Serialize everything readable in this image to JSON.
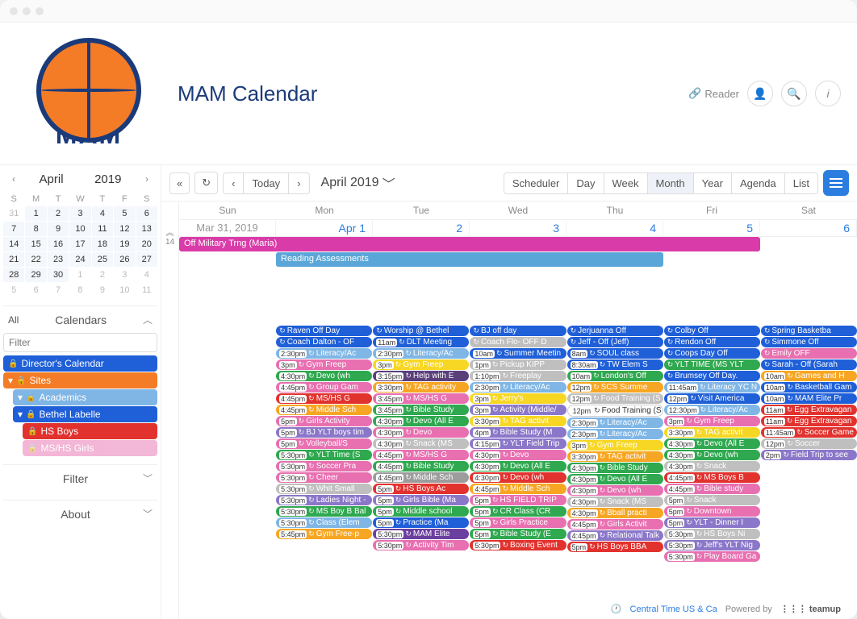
{
  "header": {
    "logo_text": "MAM",
    "title": "MAM Calendar",
    "reader": "Reader"
  },
  "minical": {
    "month": "April",
    "year": "2019",
    "dow": [
      "S",
      "M",
      "T",
      "W",
      "T",
      "F",
      "S"
    ],
    "days": [
      {
        "n": "31",
        "out": true
      },
      {
        "n": "1"
      },
      {
        "n": "2"
      },
      {
        "n": "3"
      },
      {
        "n": "4"
      },
      {
        "n": "5"
      },
      {
        "n": "6"
      },
      {
        "n": "7"
      },
      {
        "n": "8"
      },
      {
        "n": "9"
      },
      {
        "n": "10"
      },
      {
        "n": "11"
      },
      {
        "n": "12"
      },
      {
        "n": "13"
      },
      {
        "n": "14"
      },
      {
        "n": "15"
      },
      {
        "n": "16"
      },
      {
        "n": "17"
      },
      {
        "n": "18"
      },
      {
        "n": "19"
      },
      {
        "n": "20"
      },
      {
        "n": "21"
      },
      {
        "n": "22"
      },
      {
        "n": "23"
      },
      {
        "n": "24"
      },
      {
        "n": "25"
      },
      {
        "n": "26"
      },
      {
        "n": "27"
      },
      {
        "n": "28"
      },
      {
        "n": "29"
      },
      {
        "n": "30"
      },
      {
        "n": "1",
        "out": true
      },
      {
        "n": "2",
        "out": true
      },
      {
        "n": "3",
        "out": true
      },
      {
        "n": "4",
        "out": true
      },
      {
        "n": "5",
        "out": true
      },
      {
        "n": "6",
        "out": true
      },
      {
        "n": "7",
        "out": true
      },
      {
        "n": "8",
        "out": true
      },
      {
        "n": "9",
        "out": true
      },
      {
        "n": "10",
        "out": true
      },
      {
        "n": "11",
        "out": true
      }
    ]
  },
  "sidebar": {
    "all": "All",
    "calendars_label": "Calendars",
    "filter_placeholder": "Filter",
    "calendars": [
      {
        "label": "Director's Calendar",
        "color": "#1f5fd8",
        "lock": true
      },
      {
        "label": "Sites",
        "color": "#f47c26",
        "lock": true,
        "arrow": true
      },
      {
        "label": "Academics",
        "color": "#7fb6e6",
        "lock": true,
        "arrow": true,
        "indent": 1
      },
      {
        "label": "Bethel Labelle",
        "color": "#1f5fd8",
        "lock": true,
        "arrow": true,
        "indent": 1
      },
      {
        "label": "HS Boys",
        "color": "#e2322e",
        "lock": true,
        "indent": 2
      },
      {
        "label": "MS/HS Girls",
        "color": "#e86fb0",
        "lock": true,
        "indent": 2,
        "faded": true
      }
    ],
    "filter_section": "Filter",
    "about_section": "About"
  },
  "toolbar": {
    "today": "Today",
    "month_label": "April 2019",
    "views": [
      "Scheduler",
      "Day",
      "Week",
      "Month",
      "Year",
      "Agenda",
      "List"
    ],
    "active_view": "Month"
  },
  "calendar": {
    "week_num": "14",
    "dow": [
      "Sun",
      "Mon",
      "Tue",
      "Wed",
      "Thu",
      "Fri",
      "Sat"
    ],
    "dates": [
      "Mar 31, 2019",
      "Apr 1",
      "2",
      "3",
      "4",
      "5",
      "6"
    ],
    "allday": [
      {
        "label": "Off Military Trng (Maria)",
        "color": "#d93ba8",
        "span": "span6"
      },
      {
        "label": "Reading Assessments",
        "color": "#5aa6d8",
        "span": "span4"
      }
    ],
    "columns": [
      [],
      [
        {
          "t": "",
          "txt": "Raven Off Day",
          "c": "#1f5fd8"
        },
        {
          "t": "",
          "txt": "Coach Dalton - OF",
          "c": "#1f5fd8"
        },
        {
          "t": "2:30pm",
          "txt": "Literacy/Ac",
          "c": "#7fb6e6"
        },
        {
          "t": "3pm",
          "txt": "Gym Freep",
          "c": "#e86fb0"
        },
        {
          "t": "4:30pm",
          "txt": "Devo (wh",
          "c": "#2fa84f"
        },
        {
          "t": "4:45pm",
          "txt": "Group Gam",
          "c": "#e86fb0"
        },
        {
          "t": "4:45pm",
          "txt": "MS/HS G",
          "c": "#e2322e"
        },
        {
          "t": "4:45pm",
          "txt": "Middle Sch",
          "c": "#f7a623"
        },
        {
          "t": "5pm",
          "txt": "Girls Activity",
          "c": "#e86fb0"
        },
        {
          "t": "5pm",
          "txt": "BJ YLT boys tim",
          "c": "#8b77c9"
        },
        {
          "t": "5pm",
          "txt": "Volleyball/S",
          "c": "#e86fb0"
        },
        {
          "t": "5:30pm",
          "txt": "YLT Time (S",
          "c": "#2fa84f"
        },
        {
          "t": "5:30pm",
          "txt": "Soccer Pra",
          "c": "#e86fb0"
        },
        {
          "t": "5:30pm",
          "txt": "Cheer",
          "c": "#e86fb0"
        },
        {
          "t": "5:30pm",
          "txt": "Whit Small",
          "c": "#bfbfbf"
        },
        {
          "t": "5:30pm",
          "txt": "Ladies Night -",
          "c": "#8b77c9"
        },
        {
          "t": "5:30pm",
          "txt": "MS Boy B Bal",
          "c": "#2fa84f"
        },
        {
          "t": "5:30pm",
          "txt": "Class (Elem",
          "c": "#7fb6e6"
        },
        {
          "t": "5:45pm",
          "txt": "Gym Free-p",
          "c": "#f7a623"
        }
      ],
      [
        {
          "t": "",
          "txt": "Worship @ Bethel",
          "c": "#1f5fd8"
        },
        {
          "t": "11am",
          "txt": "DLT Meeting",
          "c": "#1f5fd8"
        },
        {
          "t": "2:30pm",
          "txt": "Literacy/Ac",
          "c": "#7fb6e6"
        },
        {
          "t": "3pm",
          "txt": "Gym Freep",
          "c": "#f7d723"
        },
        {
          "t": "3:15pm",
          "txt": "Help with E",
          "c": "#5a3f7a"
        },
        {
          "t": "3:30pm",
          "txt": "TAG activity",
          "c": "#f7a623"
        },
        {
          "t": "3:45pm",
          "txt": "MS/HS G",
          "c": "#e86fb0"
        },
        {
          "t": "3:45pm",
          "txt": "Bible Study",
          "c": "#2fa84f"
        },
        {
          "t": "4:30pm",
          "txt": "Devo (All E",
          "c": "#2fa84f"
        },
        {
          "t": "4:30pm",
          "txt": "Devo",
          "c": "#e86fb0"
        },
        {
          "t": "4:30pm",
          "txt": "Snack (MS",
          "c": "#bfbfbf"
        },
        {
          "t": "4:45pm",
          "txt": "MS/HS G",
          "c": "#e86fb0"
        },
        {
          "t": "4:45pm",
          "txt": "Bible Study",
          "c": "#2fa84f"
        },
        {
          "t": "4:45pm",
          "txt": "Middle Sch",
          "c": "#9c9c9c"
        },
        {
          "t": "5pm",
          "txt": "HS Boys Ac",
          "c": "#e2322e"
        },
        {
          "t": "5pm",
          "txt": "Girls Bible (Ma",
          "c": "#8b77c9"
        },
        {
          "t": "5pm",
          "txt": "Middle school",
          "c": "#2fa84f"
        },
        {
          "t": "5pm",
          "txt": "Practice (Ma",
          "c": "#1f5fd8"
        },
        {
          "t": "5:30pm",
          "txt": "MAM Elite",
          "c": "#6b3fa0"
        },
        {
          "t": "5:30pm",
          "txt": "Activity Tim",
          "c": "#e86fb0"
        }
      ],
      [
        {
          "t": "",
          "txt": "BJ off day",
          "c": "#1f5fd8"
        },
        {
          "t": "",
          "txt": "Coach Flo- OFF D",
          "c": "#bfbfbf"
        },
        {
          "t": "10am",
          "txt": "Summer Meetin",
          "c": "#1f5fd8"
        },
        {
          "t": "1pm",
          "txt": "Pickup KIPP",
          "c": "#bfbfbf"
        },
        {
          "t": "1:10pm",
          "txt": "Freeplay",
          "c": "#bfbfbf"
        },
        {
          "t": "2:30pm",
          "txt": "Literacy/Ac",
          "c": "#7fb6e6"
        },
        {
          "t": "3pm",
          "txt": "Jerry's",
          "c": "#f7d723"
        },
        {
          "t": "3pm",
          "txt": "Activity (Middle/",
          "c": "#8b77c9"
        },
        {
          "t": "3:30pm",
          "txt": "TAG activit",
          "c": "#f7d723"
        },
        {
          "t": "4pm",
          "txt": "Bible Study (M",
          "c": "#8b77c9"
        },
        {
          "t": "4:15pm",
          "txt": "YLT Field Trip",
          "c": "#8b77c9"
        },
        {
          "t": "4:30pm",
          "txt": "Devo",
          "c": "#e86fb0"
        },
        {
          "t": "4:30pm",
          "txt": "Devo (All E",
          "c": "#2fa84f"
        },
        {
          "t": "4:30pm",
          "txt": "Devo (wh",
          "c": "#e2322e"
        },
        {
          "t": "4:45pm",
          "txt": "Middle Sch",
          "c": "#f7a623"
        },
        {
          "t": "5pm",
          "txt": "HS FIELD TRIP",
          "c": "#e86fb0"
        },
        {
          "t": "5pm",
          "txt": "CR Class (CR",
          "c": "#2fa84f"
        },
        {
          "t": "5pm",
          "txt": "Girls Practice",
          "c": "#e86fb0"
        },
        {
          "t": "5pm",
          "txt": "Bible Study (E",
          "c": "#2fa84f"
        },
        {
          "t": "5:30pm",
          "txt": "Boxing Event",
          "c": "#e2322e"
        }
      ],
      [
        {
          "t": "",
          "txt": "Jerjuanna Off",
          "c": "#1f5fd8"
        },
        {
          "t": "",
          "txt": "Jeff - Off (Jeff)",
          "c": "#1f5fd8"
        },
        {
          "t": "8am",
          "txt": "SOUL class",
          "c": "#1f5fd8"
        },
        {
          "t": "8:30am",
          "txt": "TW Elem S",
          "c": "#1f5fd8"
        },
        {
          "t": "10am",
          "txt": "London's Off",
          "c": "#2fa84f"
        },
        {
          "t": "12pm",
          "txt": "SCS Summe",
          "c": "#f7a623"
        },
        {
          "t": "12pm",
          "txt": "Food Training (S",
          "c": "#bfbfbf"
        },
        {
          "t": "12pm",
          "txt": "Food Training (S",
          "c": "#ffffff",
          "tc": "#333"
        },
        {
          "t": "2:30pm",
          "txt": "Literacy/Ac",
          "c": "#7fb6e6"
        },
        {
          "t": "2:30pm",
          "txt": "Literacy/Ac",
          "c": "#7fb6e6"
        },
        {
          "t": "3pm",
          "txt": "Gym Freep",
          "c": "#f7d723"
        },
        {
          "t": "3:30pm",
          "txt": "TAG activit",
          "c": "#f7a623"
        },
        {
          "t": "4:30pm",
          "txt": "Bible Study",
          "c": "#2fa84f"
        },
        {
          "t": "4:30pm",
          "txt": "Devo (All E",
          "c": "#2fa84f"
        },
        {
          "t": "4:30pm",
          "txt": "Devo (wh",
          "c": "#e86fb0"
        },
        {
          "t": "4:30pm",
          "txt": "Snack (MS",
          "c": "#bfbfbf"
        },
        {
          "t": "4:30pm",
          "txt": "Bball practi",
          "c": "#f7a623"
        },
        {
          "t": "4:45pm",
          "txt": "Girls Activit",
          "c": "#e86fb0"
        },
        {
          "t": "4:45pm",
          "txt": "Relational Talk",
          "c": "#8b77c9"
        },
        {
          "t": "5pm",
          "txt": "HS Boys BBA",
          "c": "#e2322e"
        }
      ],
      [
        {
          "t": "",
          "txt": "Colby Off",
          "c": "#1f5fd8"
        },
        {
          "t": "",
          "txt": "Rendon Off",
          "c": "#1f5fd8"
        },
        {
          "t": "",
          "txt": "Coops Day Off",
          "c": "#1f5fd8"
        },
        {
          "t": "",
          "txt": "YLT TIME (MS YLT",
          "c": "#2fa84f"
        },
        {
          "t": "",
          "txt": "Brumsey Off Day.",
          "c": "#1f5fd8"
        },
        {
          "t": "11:45am",
          "txt": "Literacy YC N",
          "c": "#7fb6e6"
        },
        {
          "t": "12pm",
          "txt": "Visit America",
          "c": "#1f5fd8"
        },
        {
          "t": "12:30pm",
          "txt": "Literacy/Ac",
          "c": "#7fb6e6"
        },
        {
          "t": "3pm",
          "txt": "Gym Freep",
          "c": "#e86fb0"
        },
        {
          "t": "3:30pm",
          "txt": "TAG activit",
          "c": "#f7d723"
        },
        {
          "t": "4:30pm",
          "txt": "Devo (All E",
          "c": "#2fa84f"
        },
        {
          "t": "4:30pm",
          "txt": "Devo (wh",
          "c": "#2fa84f"
        },
        {
          "t": "4:30pm",
          "txt": "Snack",
          "c": "#bfbfbf"
        },
        {
          "t": "4:45pm",
          "txt": "MS Boys B",
          "c": "#e2322e"
        },
        {
          "t": "4:45pm",
          "txt": "Bible study",
          "c": "#e86fb0"
        },
        {
          "t": "5pm",
          "txt": "Snack",
          "c": "#bfbfbf"
        },
        {
          "t": "5pm",
          "txt": "Downtown",
          "c": "#e86fb0"
        },
        {
          "t": "5pm",
          "txt": "YLT - Dinner I",
          "c": "#8b77c9"
        },
        {
          "t": "5:30pm",
          "txt": "HS Boys Ni",
          "c": "#bfbfbf"
        },
        {
          "t": "5:30pm",
          "txt": "Jeff's YLT Nig",
          "c": "#8b77c9"
        },
        {
          "t": "5:30pm",
          "txt": "Play Board Ga",
          "c": "#e86fb0"
        }
      ],
      [
        {
          "t": "",
          "txt": "Spring Basketba",
          "c": "#1f5fd8"
        },
        {
          "t": "",
          "txt": "Simmone Off",
          "c": "#1f5fd8"
        },
        {
          "t": "",
          "txt": "Emily OFF",
          "c": "#e86fb0"
        },
        {
          "t": "",
          "txt": "Sarah - Off (Sarah",
          "c": "#1f5fd8"
        },
        {
          "t": "10am",
          "txt": "Games and H",
          "c": "#f7a623"
        },
        {
          "t": "10am",
          "txt": "Basketball Gam",
          "c": "#1f5fd8"
        },
        {
          "t": "10am",
          "txt": "MAM Elite Pr",
          "c": "#1f5fd8"
        },
        {
          "t": "11am",
          "txt": "Egg Extravagan",
          "c": "#e2322e"
        },
        {
          "t": "11am",
          "txt": "Egg Extravagan",
          "c": "#e2322e"
        },
        {
          "t": "11:45am",
          "txt": "Soccer Game",
          "c": "#e2322e"
        },
        {
          "t": "12pm",
          "txt": "Soccer",
          "c": "#bfbfbf"
        },
        {
          "t": "2pm",
          "txt": "Field Trip to see",
          "c": "#8b77c9"
        }
      ]
    ]
  },
  "footer": {
    "tz": "Central Time US & Ca",
    "powered": "Powered by",
    "brand": "teamup"
  }
}
